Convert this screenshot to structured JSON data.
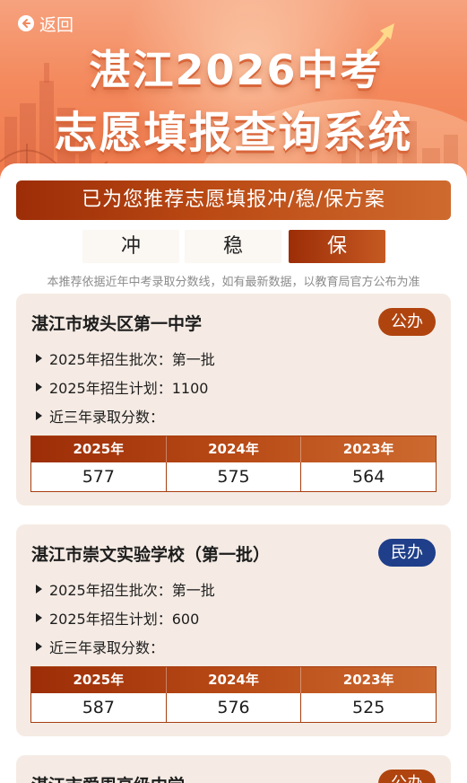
{
  "header": {
    "back_label": "返回",
    "title_line1": "湛江2026中考",
    "title_line2": "志愿填报查询系统"
  },
  "recommend": {
    "banner": "已为您推荐志愿填报冲/稳/保方案",
    "tabs": [
      "冲",
      "稳",
      "保"
    ],
    "active_tab": "保",
    "note": "本推荐依据近年中考录取分数线，如有最新数据，以教育局官方公布为准"
  },
  "schools": [
    {
      "name": "湛江市坡头区第一中学",
      "type": "公办",
      "batch": "2025年招生批次：第一批",
      "plan": "2025年招生计划：1100",
      "scores_label": "近三年录取分数：",
      "years": [
        "2025年",
        "2024年",
        "2023年"
      ],
      "scores": [
        "577",
        "575",
        "564"
      ]
    },
    {
      "name": "湛江市崇文实验学校（第一批）",
      "type": "民办",
      "batch": "2025年招生批次：第一批",
      "plan": "2025年招生计划：600",
      "scores_label": "近三年录取分数：",
      "years": [
        "2025年",
        "2024年",
        "2023年"
      ],
      "scores": [
        "587",
        "576",
        "525"
      ]
    },
    {
      "name": "湛江市爱周高级中学",
      "type": "公办"
    }
  ],
  "colors": {
    "accent": "#b0440f",
    "public_badge": "#b0440f",
    "private_badge": "#1f3f8a",
    "card_bg": "#f5ebe4"
  },
  "icons": {
    "back": "arrow-left-circle-icon",
    "list_marker": "triangle-right-icon"
  }
}
